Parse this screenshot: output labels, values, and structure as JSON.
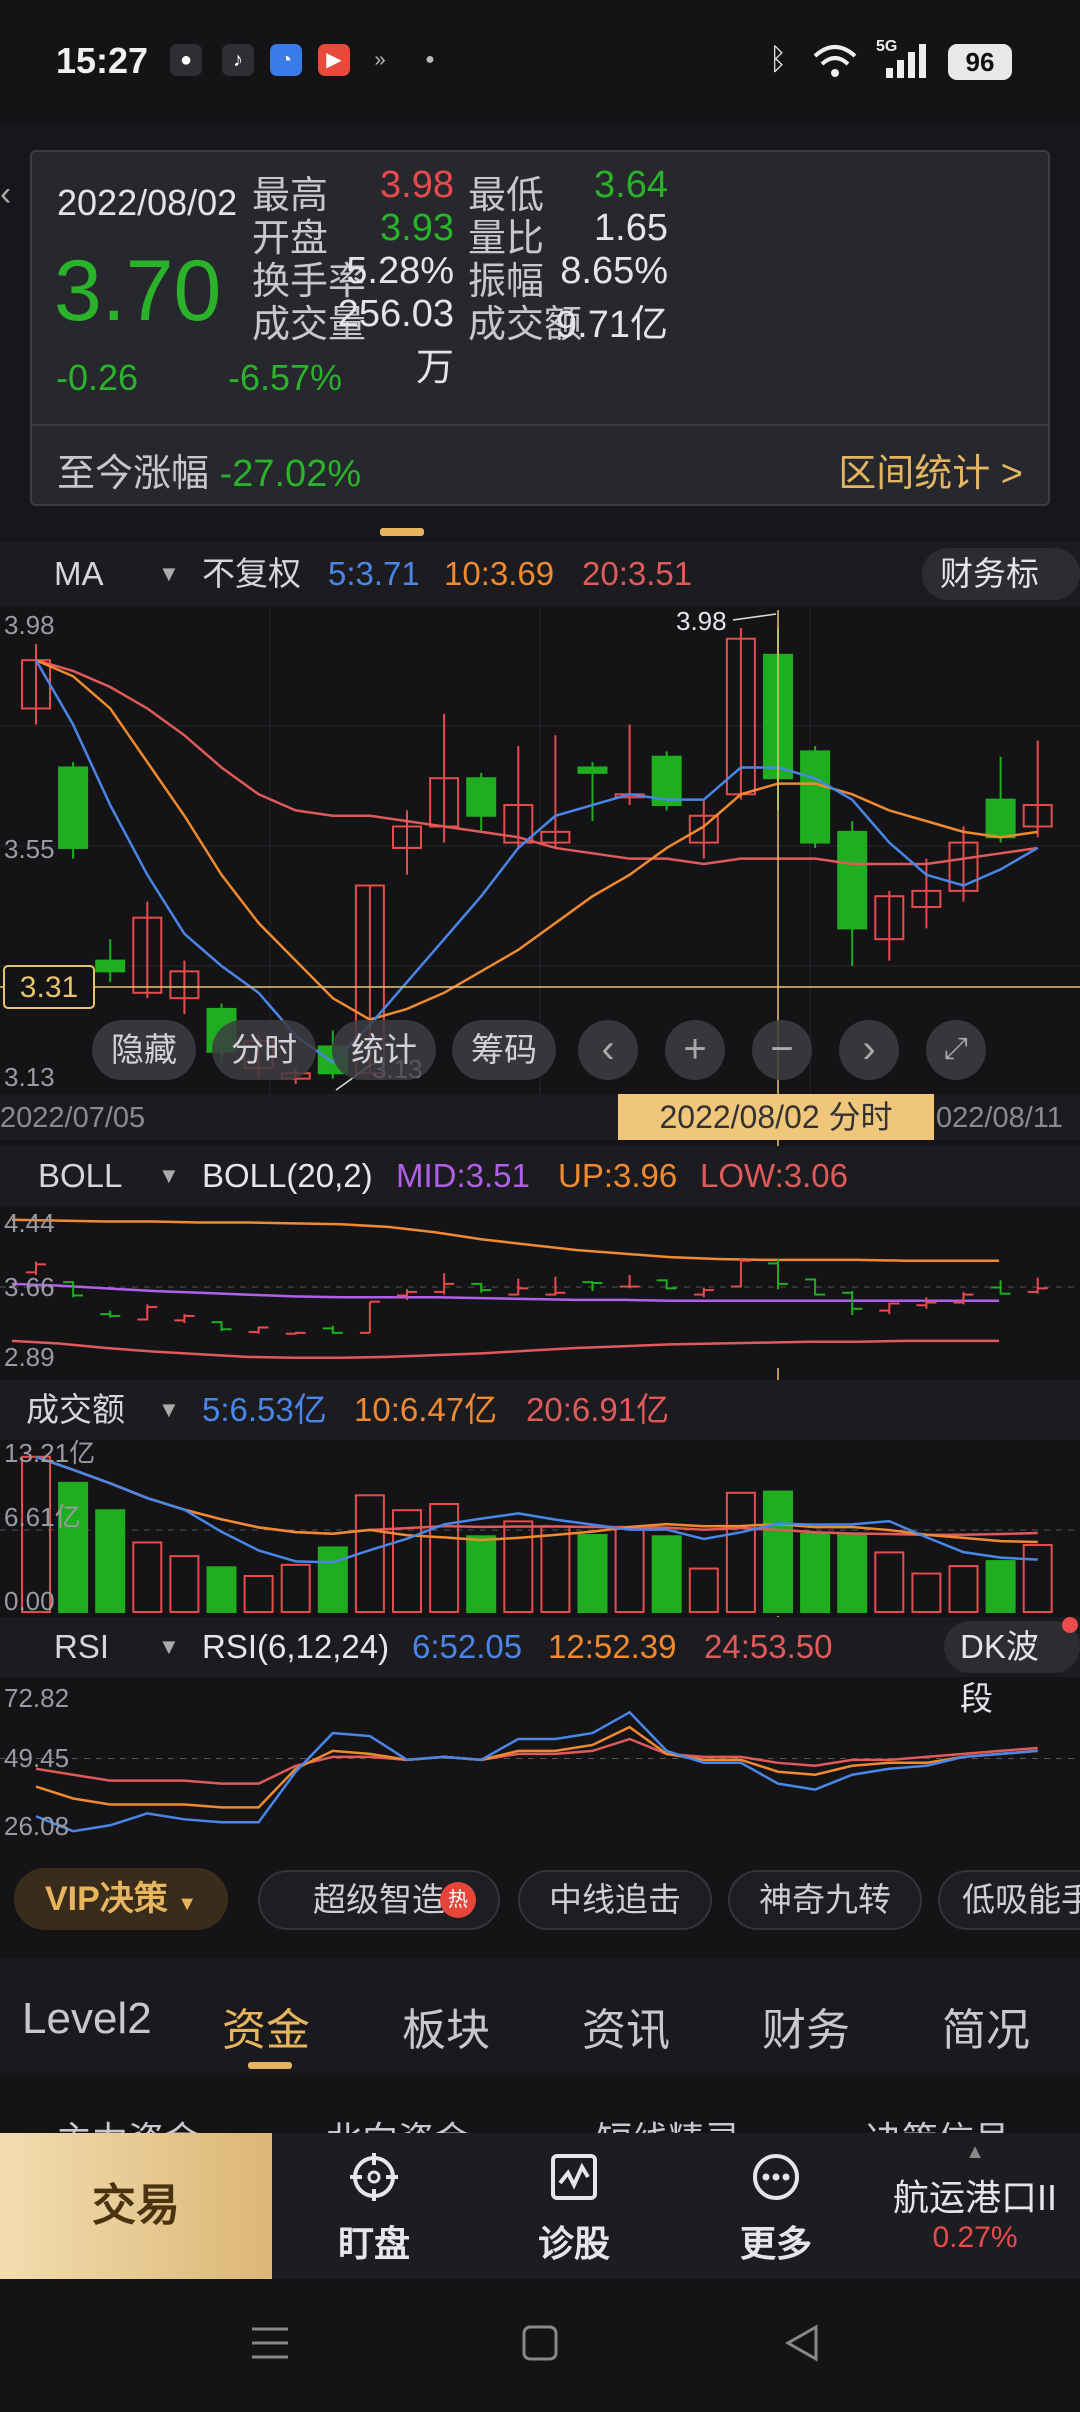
{
  "status_bar": {
    "time": "15:27",
    "apps": [
      "wechat-icon",
      "tiktok-icon",
      "qq-icon",
      "video-icon",
      "arrows-icon",
      "dot-icon"
    ],
    "network": "5G",
    "battery": "96"
  },
  "popup": {
    "date": "2022/08/02",
    "price": "3.70",
    "change": "-0.26",
    "change_pct": "-6.57%",
    "rows": [
      {
        "l1": "最高",
        "v1": "3.98",
        "c1": "#e84b4b",
        "l2": "最低",
        "v2": "3.64",
        "c2": "#2ab22a"
      },
      {
        "l1": "开盘",
        "v1": "3.93",
        "c1": "#2ab22a",
        "l2": "量比",
        "v2": "1.65",
        "c2": "#e4e4e8"
      },
      {
        "l1": "换手率",
        "v1": "5.28%",
        "c1": "#e4e4e8",
        "l2": "振幅",
        "v2": "8.65%",
        "c2": "#e4e4e8"
      },
      {
        "l1": "成交量",
        "v1": "256.03万",
        "c1": "#e4e4e8",
        "l2": "成交额",
        "v2": "9.71亿",
        "c2": "#e4e4e8"
      }
    ],
    "since_label": "至今涨幅",
    "since_value": "-27.02%",
    "stat_link": "区间统计 >"
  },
  "ma_bar": {
    "indicator": "MA",
    "fq": "不复权",
    "ma5": "5:3.71",
    "ma10": "10:3.69",
    "ma20": "20:3.51",
    "right_button": "财务标记"
  },
  "colors": {
    "up": "#e84b4b",
    "down": "#1fae1f",
    "ma5": "#4a86e8",
    "ma10": "#f08a30",
    "ma20": "#e05a5a",
    "boll_mid": "#b060e8",
    "accent": "#e6b55e"
  },
  "price_axis": {
    "top": "3.98",
    "mid": "3.55",
    "bottom": "3.13",
    "cursor": "3.31",
    "high_mark": "3.98",
    "low_mark": "3.13"
  },
  "controls": [
    "隐藏",
    "分时",
    "统计",
    "筹码"
  ],
  "date_bar": {
    "start": "2022/07/05",
    "selected": "2022/08/02 分时",
    "end": "022/08/11"
  },
  "boll_bar": {
    "indicator": "BOLL",
    "param": "BOLL(20,2)",
    "mid": "MID:3.51",
    "up": "UP:3.96",
    "low": "LOW:3.06",
    "axis": [
      "4.44",
      "3.66",
      "2.89"
    ]
  },
  "vol_bar": {
    "indicator": "成交额",
    "ma5": "5:6.53亿",
    "ma10": "10:6.47亿",
    "ma20": "20:6.91亿",
    "axis": [
      "13.21亿",
      "6.61亿",
      "0.00"
    ]
  },
  "rsi_bar": {
    "indicator": "RSI",
    "param": "RSI(6,12,24)",
    "r6": "6:52.05",
    "r12": "12:52.39",
    "r24": "24:53.50",
    "right_button": "DK波段",
    "axis": [
      "72.82",
      "49.45",
      "26.08"
    ]
  },
  "vip_bar": {
    "vip": "VIP决策",
    "chips": [
      "超级智造",
      "中线追击",
      "神奇九转",
      "低吸能手"
    ],
    "hot": "热"
  },
  "tabs": {
    "items": [
      "Level2",
      "资金",
      "板块",
      "资讯",
      "财务",
      "简况"
    ],
    "active": 1
  },
  "subtabs": [
    "主力资金",
    "北向资金",
    "短线精灵",
    "决策信号"
  ],
  "bottom_bar": {
    "trade": "交易",
    "items": [
      "盯盘",
      "诊股",
      "更多"
    ],
    "stock_name": "航运港口II",
    "stock_pct": "0.27%"
  },
  "chart_data": {
    "type": "candlestick",
    "title": "",
    "x_start": "2022/07/05",
    "x_end": "2022/08/11",
    "ylim": [
      3.13,
      3.98
    ],
    "candles": [
      {
        "o": 3.83,
        "c": 3.92,
        "h": 3.95,
        "l": 3.8
      },
      {
        "o": 3.72,
        "c": 3.57,
        "h": 3.73,
        "l": 3.55
      },
      {
        "o": 3.36,
        "c": 3.34,
        "h": 3.4,
        "l": 3.32
      },
      {
        "o": 3.3,
        "c": 3.44,
        "h": 3.47,
        "l": 3.29
      },
      {
        "o": 3.29,
        "c": 3.34,
        "h": 3.36,
        "l": 3.26
      },
      {
        "o": 3.27,
        "c": 3.19,
        "h": 3.28,
        "l": 3.17
      },
      {
        "o": 3.16,
        "c": 3.21,
        "h": 3.22,
        "l": 3.14
      },
      {
        "o": 3.14,
        "c": 3.15,
        "h": 3.16,
        "l": 3.13
      },
      {
        "o": 3.2,
        "c": 3.15,
        "h": 3.23,
        "l": 3.14
      },
      {
        "o": 3.15,
        "c": 3.5,
        "h": 3.5,
        "l": 3.15
      },
      {
        "o": 3.57,
        "c": 3.61,
        "h": 3.64,
        "l": 3.52
      },
      {
        "o": 3.61,
        "c": 3.7,
        "h": 3.82,
        "l": 3.58
      },
      {
        "o": 3.7,
        "c": 3.63,
        "h": 3.71,
        "l": 3.6
      },
      {
        "o": 3.58,
        "c": 3.65,
        "h": 3.76,
        "l": 3.57
      },
      {
        "o": 3.58,
        "c": 3.6,
        "h": 3.78,
        "l": 3.57
      },
      {
        "o": 3.72,
        "c": 3.71,
        "h": 3.73,
        "l": 3.62
      },
      {
        "o": 3.67,
        "c": 3.67,
        "h": 3.8,
        "l": 3.65
      },
      {
        "o": 3.74,
        "c": 3.65,
        "h": 3.75,
        "l": 3.64
      },
      {
        "o": 3.58,
        "c": 3.63,
        "h": 3.66,
        "l": 3.55
      },
      {
        "o": 3.67,
        "c": 3.96,
        "h": 3.98,
        "l": 3.66
      },
      {
        "o": 3.93,
        "c": 3.7,
        "h": 3.98,
        "l": 3.64
      },
      {
        "o": 3.75,
        "c": 3.58,
        "h": 3.76,
        "l": 3.57
      },
      {
        "o": 3.6,
        "c": 3.42,
        "h": 3.62,
        "l": 3.35
      },
      {
        "o": 3.4,
        "c": 3.48,
        "h": 3.49,
        "l": 3.36
      },
      {
        "o": 3.46,
        "c": 3.49,
        "h": 3.55,
        "l": 3.42
      },
      {
        "o": 3.49,
        "c": 3.58,
        "h": 3.61,
        "l": 3.47
      },
      {
        "o": 3.66,
        "c": 3.59,
        "h": 3.74,
        "l": 3.58
      },
      {
        "o": 3.61,
        "c": 3.65,
        "h": 3.77,
        "l": 3.59
      }
    ],
    "ma5": [
      3.92,
      3.8,
      3.65,
      3.52,
      3.41,
      3.35,
      3.3,
      3.22,
      3.17,
      3.24,
      3.32,
      3.4,
      3.48,
      3.57,
      3.63,
      3.65,
      3.67,
      3.66,
      3.66,
      3.72,
      3.72,
      3.7,
      3.66,
      3.58,
      3.52,
      3.5,
      3.53,
      3.57
    ],
    "ma10": [
      3.92,
      3.89,
      3.83,
      3.73,
      3.63,
      3.52,
      3.43,
      3.36,
      3.29,
      3.25,
      3.27,
      3.3,
      3.34,
      3.38,
      3.43,
      3.48,
      3.52,
      3.57,
      3.61,
      3.67,
      3.69,
      3.69,
      3.67,
      3.64,
      3.62,
      3.6,
      3.59,
      3.6
    ],
    "ma20": [
      3.92,
      3.9,
      3.87,
      3.83,
      3.78,
      3.72,
      3.67,
      3.64,
      3.63,
      3.63,
      3.62,
      3.61,
      3.6,
      3.59,
      3.57,
      3.56,
      3.55,
      3.55,
      3.54,
      3.55,
      3.55,
      3.55,
      3.54,
      3.54,
      3.54,
      3.55,
      3.56,
      3.57
    ],
    "volume": [
      12.5,
      10.4,
      8.2,
      5.6,
      4.5,
      3.6,
      2.9,
      3.8,
      5.2,
      9.4,
      8.2,
      8.7,
      6.1,
      7.3,
      6.9,
      6.2,
      6.7,
      6.1,
      3.5,
      9.6,
      9.7,
      6.3,
      6.2,
      4.8,
      3.1,
      3.7,
      4.1,
      5.4
    ],
    "rsi6": [
      30,
      25,
      27,
      31,
      29,
      28,
      28,
      45,
      58,
      57,
      49,
      50,
      49,
      56,
      56,
      58,
      65,
      52,
      48,
      48,
      41,
      39,
      44,
      46,
      47,
      50,
      51,
      52
    ],
    "rsi12": [
      40,
      36,
      34,
      34,
      34,
      33,
      33,
      46,
      52,
      51,
      49,
      50,
      49,
      52,
      52,
      54,
      60,
      51,
      49,
      49,
      45,
      44,
      47,
      48,
      48,
      50,
      51,
      52
    ],
    "rsi24": [
      46,
      44,
      42,
      42,
      42,
      41,
      41,
      47,
      50,
      50,
      49,
      50,
      49,
      51,
      51,
      52,
      56,
      51,
      50,
      50,
      48,
      47,
      49,
      49,
      50,
      51,
      52,
      53
    ],
    "boll_up": [
      4.42,
      4.41,
      4.4,
      4.4,
      4.39,
      4.39,
      4.38,
      4.37,
      4.34,
      4.28,
      4.2,
      4.14,
      4.08,
      4.04,
      4.0,
      3.98,
      3.97,
      3.97,
      3.97,
      3.96,
      3.96,
      3.96
    ],
    "boll_mid": [
      3.7,
      3.68,
      3.65,
      3.62,
      3.6,
      3.58,
      3.56,
      3.55,
      3.55,
      3.55,
      3.54,
      3.53,
      3.52,
      3.52,
      3.51,
      3.51,
      3.51,
      3.51,
      3.51,
      3.51,
      3.51,
      3.51
    ],
    "boll_low": [
      3.06,
      3.03,
      2.98,
      2.94,
      2.91,
      2.88,
      2.87,
      2.87,
      2.88,
      2.9,
      2.92,
      2.95,
      2.98,
      3.0,
      3.02,
      3.03,
      3.04,
      3.05,
      3.05,
      3.06,
      3.06,
      3.06
    ],
    "cursor_index": 20
  }
}
